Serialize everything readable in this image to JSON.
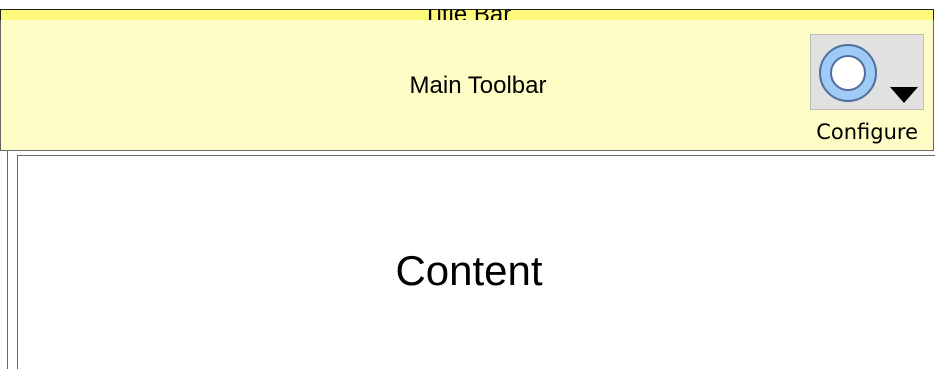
{
  "title_bar": {
    "label": "Title Bar"
  },
  "toolbar": {
    "label": "Main Toolbar",
    "configure_button": {
      "label": "Configure",
      "icon": "gear-icon"
    }
  },
  "content": {
    "label": "Content"
  },
  "colors": {
    "title_bar": "#fff97c",
    "toolbar": "#fffdc6",
    "content": "#ffffff",
    "icon_ring_fill": "#9fcaf5",
    "icon_ring_stroke": "#4f6f9e",
    "icon_tile": "#e1e1e1"
  }
}
